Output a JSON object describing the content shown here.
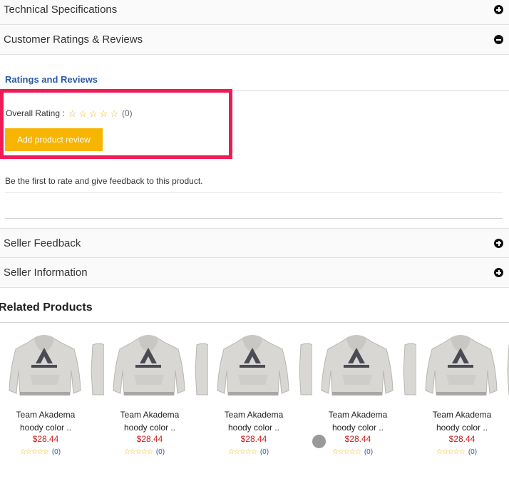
{
  "accordion": {
    "technical_specifications": "Technical Specifications",
    "customer_ratings_reviews": "Customer Ratings & Reviews",
    "seller_feedback": "Seller Feedback",
    "seller_information": "Seller Information"
  },
  "reviews": {
    "section_title": "Ratings and Reviews",
    "overall_rating_label": "Overall Rating :",
    "overall_stars": 0,
    "overall_count": "(0)",
    "add_review_label": "Add product review",
    "first_rate_text": "Be the first to rate and give feedback to this product."
  },
  "related": {
    "title": "Related Products",
    "products": [
      {
        "name_line1": "Team Akadema",
        "name_line2": "hoody color ..",
        "price": "$28.44",
        "rating_count": "(0)"
      },
      {
        "name_line1": "Team Akadema",
        "name_line2": "hoody color ..",
        "price": "$28.44",
        "rating_count": "(0)"
      },
      {
        "name_line1": "Team Akadema",
        "name_line2": "hoody color ..",
        "price": "$28.44",
        "rating_count": "(0)"
      },
      {
        "name_line1": "Team Akadema",
        "name_line2": "hoody color ..",
        "price": "$28.44",
        "rating_count": "(0)"
      },
      {
        "name_line1": "Team Akadema",
        "name_line2": "hoody color ..",
        "price": "$28.44",
        "rating_count": "(0)"
      }
    ]
  },
  "colors": {
    "accent_yellow": "#f7b400",
    "highlight_border": "#f01a55",
    "link_blue": "#2a5ba8",
    "price_red": "#d01c1c"
  }
}
